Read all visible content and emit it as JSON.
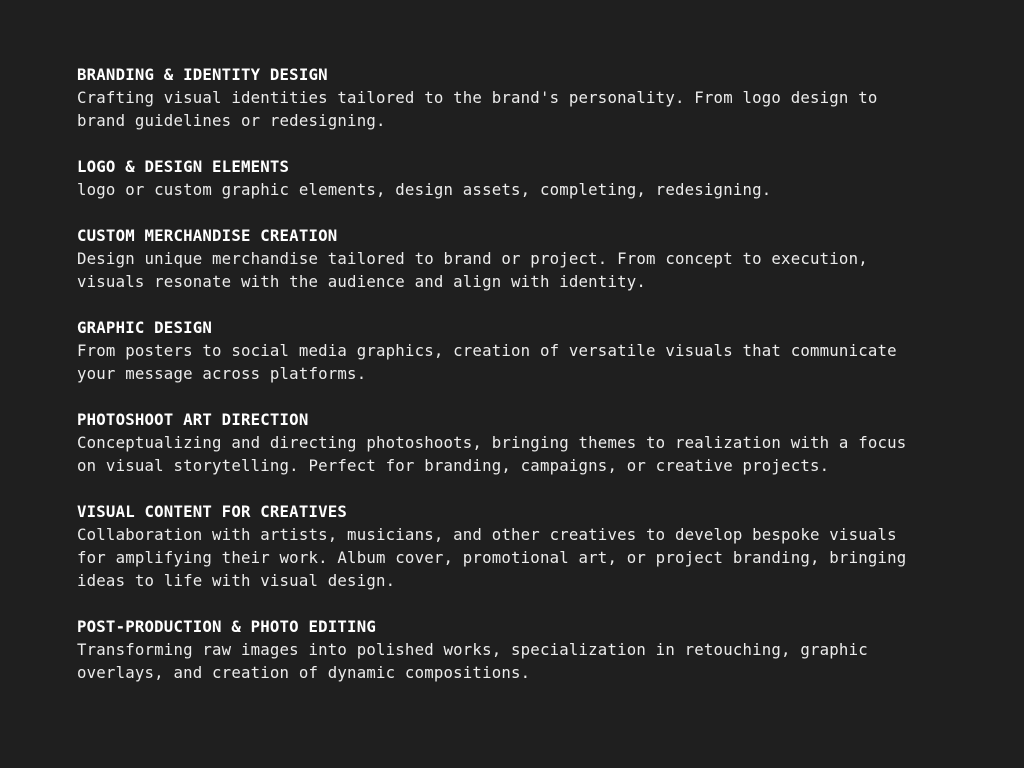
{
  "services": [
    {
      "title": "BRANDING & IDENTITY DESIGN",
      "description": "Crafting visual identities tailored to the brand's personality. From logo design to\nbrand guidelines or redesigning."
    },
    {
      "title": "LOGO & DESIGN ELEMENTS",
      "description": "logo or custom graphic elements, design assets, completing, redesigning."
    },
    {
      "title": "CUSTOM MERCHANDISE CREATION",
      "description": "Design unique merchandise tailored to brand or project. From concept to execution,\nvisuals resonate with the audience and align with identity."
    },
    {
      "title": "GRAPHIC DESIGN",
      "description": "From posters to social media graphics, creation of versatile visuals that communicate\nyour message across platforms."
    },
    {
      "title": "PHOTOSHOOT ART DIRECTION",
      "description": "Conceptualizing and directing photoshoots, bringing themes to realization with a focus\non visual storytelling. Perfect for branding, campaigns, or creative projects."
    },
    {
      "title": "VISUAL CONTENT FOR CREATIVES",
      "description": "Collaboration with artists, musicians, and other creatives to develop bespoke visuals\nfor amplifying their work. Album cover, promotional art, or project branding, bringing\nideas to life with visual design."
    },
    {
      "title": "POST-PRODUCTION & PHOTO EDITING",
      "description": "Transforming raw images into polished works, specialization in retouching, graphic\noverlays, and creation of dynamic compositions."
    }
  ],
  "colors": {
    "background": "#1f1f1f",
    "title": "#ffffff",
    "text": "#ececec"
  }
}
